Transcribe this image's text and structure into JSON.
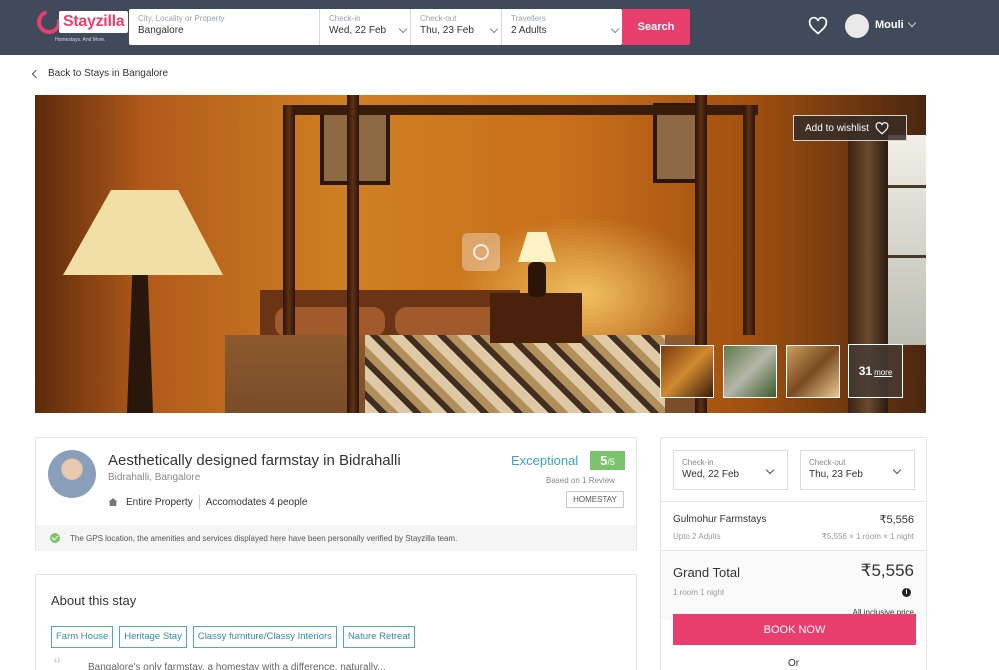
{
  "header": {
    "brand": "Stayzilla",
    "tagline": "Homestays. And More.",
    "location": {
      "label": "City, Locality or Property",
      "value": "Bangalore"
    },
    "checkin": {
      "label": "Check-in",
      "value": "Wed, 22 Feb"
    },
    "checkout": {
      "label": "Check-out",
      "value": "Thu, 23 Feb"
    },
    "travellers": {
      "label": "Travellers",
      "value": "2 Adults"
    },
    "search_label": "Search",
    "user_name": "Mouli"
  },
  "nav": {
    "back_label": "Back to Stays in Bangalore"
  },
  "gallery": {
    "wishlist_label": "Add to wishlist",
    "more_count": "31",
    "more_label": "more"
  },
  "property": {
    "title": "Aesthetically designed farmstay in Bidrahalli",
    "location": "Bidrahalli, Bangalore",
    "type_feature": "Entire Property",
    "capacity": "Accomodates 4 people",
    "rating_word": "Exceptional",
    "rating": "5",
    "rating_scale": "/5",
    "review_count": "Based on 1 Review",
    "badge": "HOMESTAY",
    "verified_text": "The GPS location, the amenities and services displayed here have been personally verified by Stayzilla team."
  },
  "about": {
    "title": "About this stay",
    "tags": [
      "Farm House",
      "Heritage Stay",
      "Classy furniture/Classy Interiors",
      "Nature Retreat"
    ],
    "description": "Bangalore's only farmstay, a homestay with a difference, naturally..."
  },
  "booking": {
    "checkin": {
      "label": "Check-in",
      "value": "Wed, 22 Feb"
    },
    "checkout": {
      "label": "Check-out",
      "value": "Thu, 23 Feb"
    },
    "room_name": "Gulmohur Farmstays",
    "room_price": "₹5,556",
    "room_occupancy": "Upto 2 Adults",
    "room_calc": "₹5,556 × 1 room × 1 night",
    "grand_total_label": "Grand Total",
    "grand_total_value": "₹5,556",
    "grand_total_sub": "1 room 1 night",
    "inclusive_label": "All inclusive price",
    "book_label": "BOOK NOW",
    "or_label": "Or"
  },
  "colors": {
    "brand_pink": "#e93f6e",
    "header_bg": "#414a5a",
    "rating_green": "#7cc36d",
    "link_blue": "#3aa4c5"
  }
}
